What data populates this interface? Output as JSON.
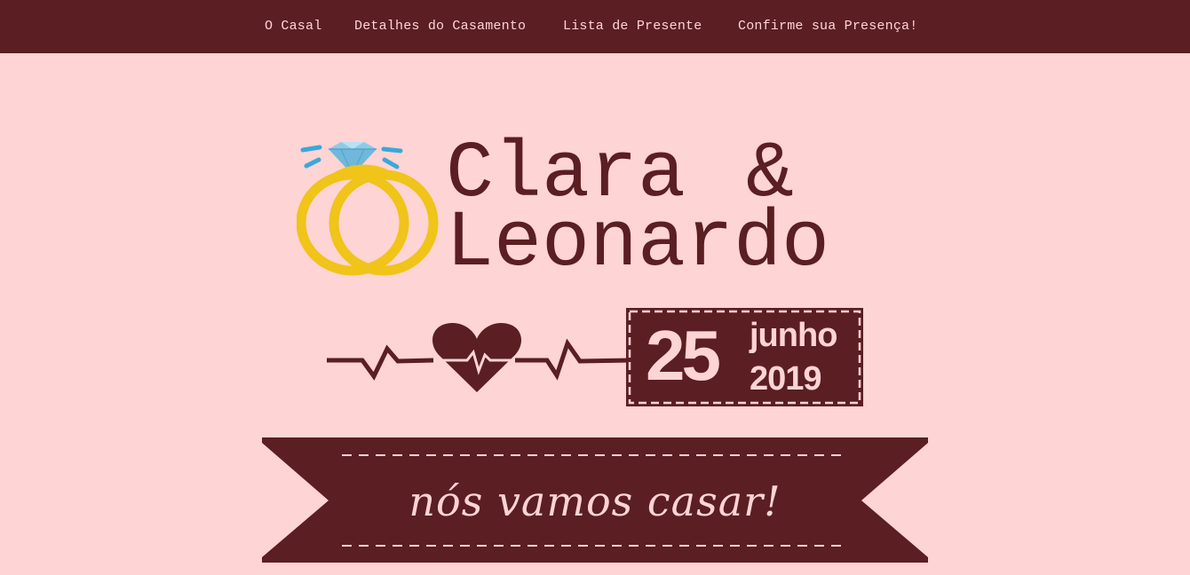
{
  "nav": {
    "items": [
      {
        "label": "O Casal"
      },
      {
        "label": "Detalhes do Casamento"
      },
      {
        "label": "Lista de Presente"
      },
      {
        "label": "Confirme sua Presença!"
      }
    ]
  },
  "hero": {
    "rings_icon": "wedding-rings-diamond",
    "name_first": "Clara",
    "ampersand": "&",
    "name_second": "Leonardo",
    "heartbeat_icon": "heart-pulse-line",
    "date": {
      "day": "25",
      "month": "junho",
      "year": "2019"
    },
    "ribbon_text": "nós vamos casar!"
  },
  "colors": {
    "background": "#ffd4d4",
    "primary": "#5a1e23",
    "ring_gold": "#f0c419",
    "diamond_blue": "#8ecae6",
    "sparkle_blue": "#3aa8d8"
  }
}
